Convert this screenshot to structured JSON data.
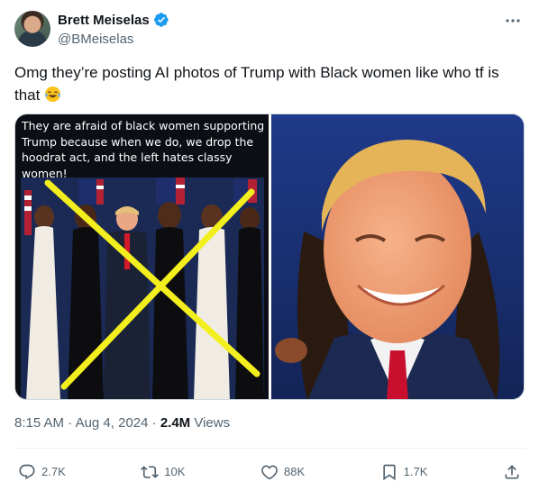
{
  "author": {
    "display_name": "Brett Meiselas",
    "handle": "@BMeiselas",
    "verified": true
  },
  "tweet": {
    "text": "Omg they’re posting AI photos of Trump with Black women like who tf is that",
    "emoji": "tears-of-joy"
  },
  "media": {
    "left_caption": "They are afraid of black women supporting Trump because when we do, we drop the hoodrat act, and the left hates classy women!",
    "left_overlay": "yellow-x-mark"
  },
  "meta": {
    "time": "8:15 AM",
    "date": "Aug 4, 2024",
    "separator": "·",
    "views_count": "2.4M",
    "views_label": "Views"
  },
  "actions": {
    "replies": "2.7K",
    "reposts": "10K",
    "likes": "88K",
    "bookmarks": "1.7K"
  },
  "colors": {
    "verified": "#1d9bf0",
    "text_primary": "#0f1419",
    "text_secondary": "#536471",
    "overlay_x": "#f3ef1e"
  }
}
